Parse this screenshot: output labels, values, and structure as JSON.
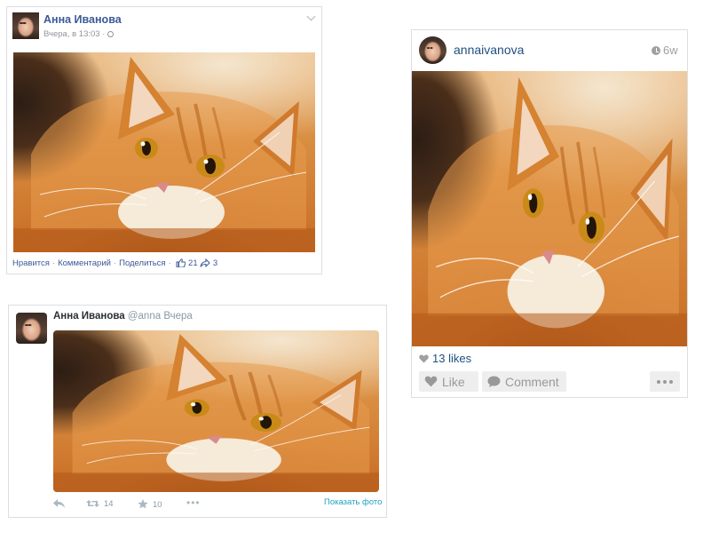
{
  "facebook": {
    "author": "Анна Иванова",
    "time": "Вчера, в 13:03 ·",
    "actions": {
      "like": "Нравится",
      "comment": "Комментарий",
      "share": "Поделиться"
    },
    "likes_count": "21",
    "shares_count": "3"
  },
  "instagram": {
    "username": "annaivanova",
    "age": "6w",
    "likes": "13 likes",
    "like_label": "Like",
    "comment_label": "Comment"
  },
  "twitter": {
    "name": "Анна Иванова",
    "handle": "@anna",
    "time": "Вчера",
    "retweets": "14",
    "favorites": "10",
    "show_photo": "Показать фото"
  },
  "icons": {
    "fb_like": "thumbs-up-icon",
    "fb_share": "share-arrow-icon",
    "ig_heart": "heart-icon",
    "ig_comment": "speech-bubble-icon",
    "ig_clock": "clock-icon",
    "tw_reply": "reply-icon",
    "tw_retweet": "retweet-icon",
    "tw_star": "star-icon",
    "tw_more": "more-dots-icon"
  },
  "colors": {
    "facebook_link": "#3b5998",
    "instagram_link": "#205080",
    "twitter_link": "#1da1c2",
    "muted": "#90949c"
  }
}
